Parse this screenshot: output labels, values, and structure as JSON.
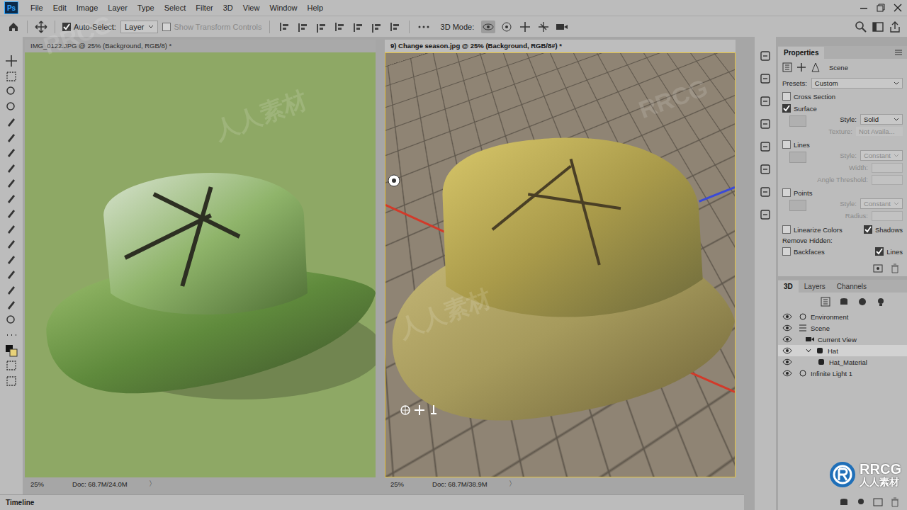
{
  "menu": {
    "logo": "Ps",
    "items": [
      "File",
      "Edit",
      "Image",
      "Layer",
      "Type",
      "Select",
      "Filter",
      "3D",
      "View",
      "Window",
      "Help"
    ]
  },
  "options": {
    "auto_select": {
      "label": "Auto-Select:",
      "checked": true
    },
    "target": "Layer",
    "transform_controls": {
      "label": "Show Transform Controls",
      "checked": false,
      "disabled": true
    },
    "mode_label": "3D Mode:"
  },
  "documents": [
    {
      "title": "IMG_0122.JPG @ 25% (Background, RGB/8) *",
      "selected": false,
      "zoom": "25%",
      "doc": "Doc: 68.7M/24.0M",
      "arrow": "〉",
      "kind": "photo"
    },
    {
      "title": "9) Change season.jpg @ 25% (Background, RGB/8#) *",
      "selected": true,
      "zoom": "25%",
      "doc": "Doc: 68.7M/38.9M",
      "arrow": "〉",
      "kind": "scene3d"
    }
  ],
  "properties": {
    "tab": "Properties",
    "header": "Scene",
    "presets": {
      "label": "Presets:",
      "value": "Custom"
    },
    "sections": [
      {
        "label": "Cross Section",
        "checked": false,
        "fields": []
      },
      {
        "label": "Surface",
        "checked": true,
        "fields": [
          {
            "label": "Style:",
            "value": "Solid",
            "disabled": false
          },
          {
            "label": "Texture:",
            "value": "Not Availa...",
            "disabled": true
          }
        ]
      },
      {
        "label": "Lines",
        "checked": false,
        "fields": [
          {
            "label": "Style:",
            "value": "Constant",
            "disabled": true
          },
          {
            "label": "Width:",
            "disabled": true
          },
          {
            "label": "Angle Threshold:",
            "disabled": true
          }
        ]
      },
      {
        "label": "Points",
        "checked": false,
        "fields": [
          {
            "label": "Style:",
            "value": "Constant",
            "disabled": true
          },
          {
            "label": "Radius:",
            "disabled": true
          }
        ]
      }
    ],
    "flags": [
      {
        "label": "Linearize Colors",
        "checked": false
      },
      {
        "label": "Shadows",
        "checked": true
      }
    ],
    "remove_hidden": "Remove Hidden:",
    "hidden_flags": [
      {
        "label": "Backfaces",
        "checked": false
      },
      {
        "label": "Lines",
        "checked": true
      }
    ]
  },
  "panel3d": {
    "tabs": [
      {
        "label": "3D",
        "selected": true
      },
      {
        "label": "Layers",
        "selected": false
      },
      {
        "label": "Channels",
        "selected": false
      }
    ],
    "items": [
      {
        "label": "Environment",
        "kind": "environment",
        "visible": true,
        "selected": false
      },
      {
        "label": "Scene",
        "kind": "scene",
        "visible": true,
        "selected": false
      },
      {
        "label": "Current View",
        "kind": "view",
        "visible": true,
        "selected": false
      },
      {
        "label": "Hat",
        "kind": "mesh",
        "visible": true,
        "selected": true,
        "expanded": true
      },
      {
        "label": "Hat_Material",
        "kind": "material",
        "visible": true,
        "selected": false
      },
      {
        "label": "Infinite Light 1",
        "kind": "light",
        "visible": true,
        "selected": false
      }
    ]
  },
  "timeline": "Timeline",
  "watermark": {
    "logo": "RRCG",
    "brand": "人人素材",
    "marks": [
      "RRCG",
      "人人素材",
      "人人素材",
      "RRCG"
    ]
  }
}
